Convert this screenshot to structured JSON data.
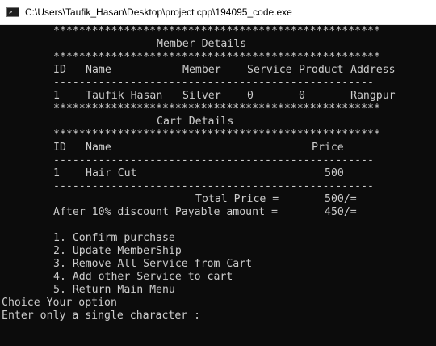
{
  "window": {
    "title": "C:\\Users\\Taufik_Hasan\\Desktop\\project cpp\\194095_code.exe",
    "icon": "console-app-icon"
  },
  "console": {
    "star_line": "***************************************************",
    "dash_line": "--------------------------------------------------",
    "member_section": {
      "title": "Member Details",
      "headers": {
        "id": "ID",
        "name": "Name",
        "member": "Member",
        "service": "Service",
        "product": "Product",
        "address": "Address"
      },
      "row": {
        "id": "1",
        "name": "Taufik Hasan",
        "member": "Silver",
        "service": "0",
        "product": "0",
        "address": "Rangpur"
      }
    },
    "cart_section": {
      "title": "Cart Details",
      "headers": {
        "id": "ID",
        "name": "Name",
        "price": "Price"
      },
      "row": {
        "id": "1",
        "name": "Hair Cut",
        "price": "500"
      }
    },
    "totals": {
      "total_label": "Total Price =",
      "total_value": "500/=",
      "discount_label": "After 10% discount Payable amount =",
      "discount_value": "450/="
    },
    "menu": [
      "1. Confirm purchase",
      "2. Update MemberShip",
      "3. Remove All Service from Cart",
      "4. Add other Service to cart",
      "5. Return Main Menu"
    ],
    "prompt_choice": "Choice Your option",
    "prompt_input": "Enter only a single character :"
  }
}
